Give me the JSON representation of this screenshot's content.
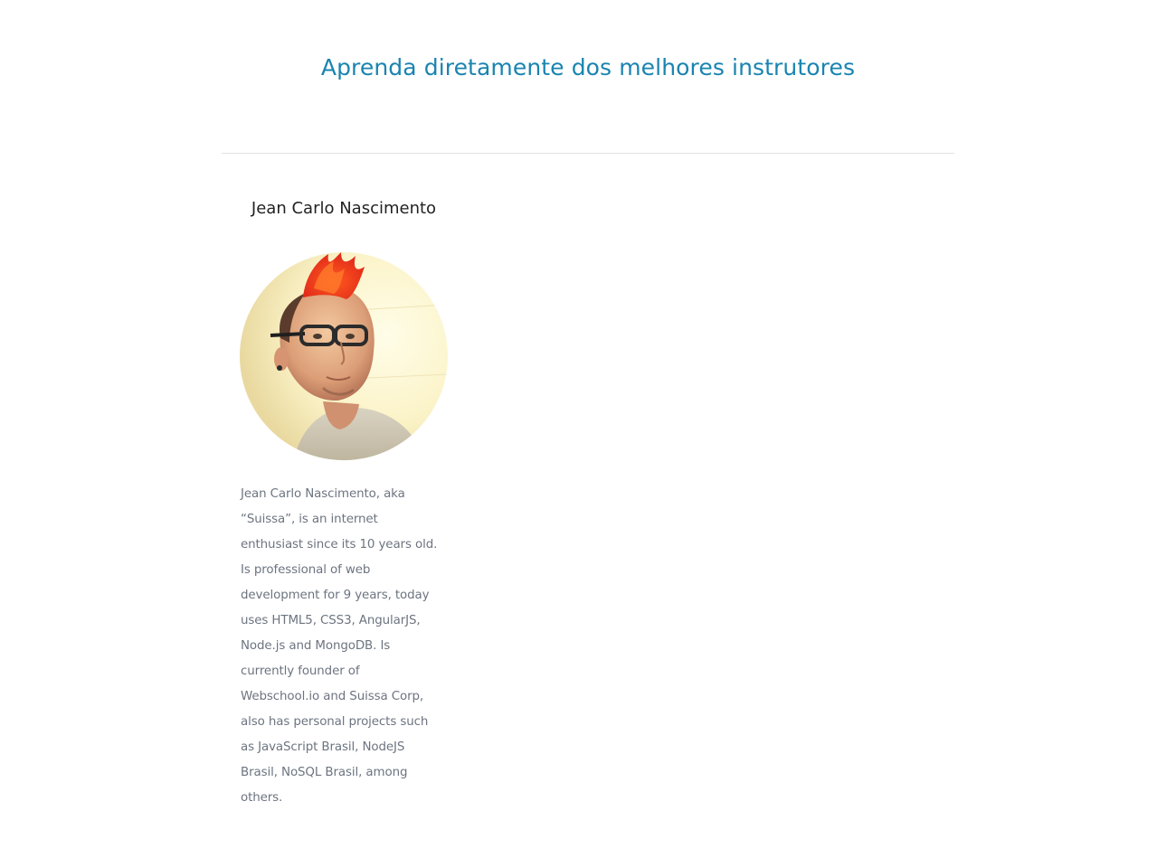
{
  "section": {
    "title": "Aprenda diretamente dos melhores instrutores"
  },
  "instructor": {
    "name": "Jean Carlo Nascimento",
    "bio": "Jean Carlo Nascimento, aka “Suissa”, is an internet enthusiast since its 10 years old. Is professional of web development for 9 years, today uses HTML5, CSS3, AngularJS, Node.js and MongoDB. Is currently founder of Webschool.io and Suissa Corp, also has personal projects such as JavaScript Brasil, NodeJS Brasil, NoSQL Brasil, among others."
  },
  "colors": {
    "title": "#1a84b0",
    "name": "#222222",
    "bio": "#6c7480",
    "divider": "#e3e3e3"
  }
}
